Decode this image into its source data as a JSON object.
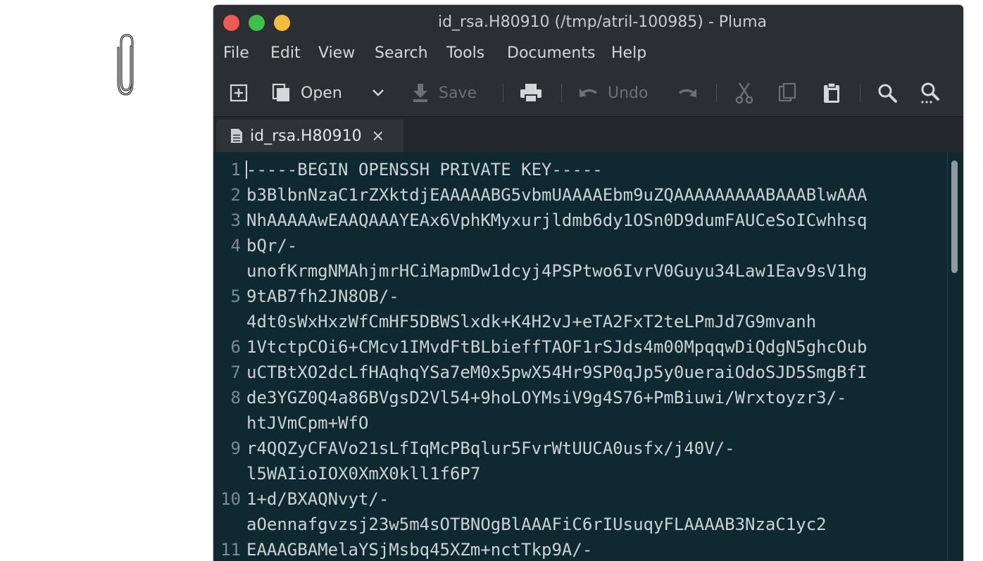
{
  "window": {
    "title": "id_rsa.H80910 (/tmp/atril-100985) - Pluma"
  },
  "menubar": [
    "File",
    "Edit",
    "View",
    "Search",
    "Tools",
    "Documents",
    "Help"
  ],
  "toolbar": {
    "new_icon": "new-document-icon",
    "open_label": "Open",
    "save_label": "Save",
    "undo_label": "Undo"
  },
  "tab": {
    "label": "id_rsa.H80910",
    "close": "×"
  },
  "editor": {
    "lines": [
      {
        "num": "1",
        "text": "-----BEGIN OPENSSH PRIVATE KEY-----"
      },
      {
        "num": "2",
        "text": "b3BlbnNzaC1rZXktdjEAAAAABG5vbmUAAAAEbm9uZQAAAAAAAAABAAABlwAAA"
      },
      {
        "num": "3",
        "text": "NhAAAAAwEAAQAAAYEAx6VphKMyxurjldmb6dy1OSn0D9dumFAUCeSoICwhhsq"
      },
      {
        "num": "4",
        "text": "bQr/-"
      },
      {
        "num": "",
        "text": "unofKrmgNMAhjmrHCiMapmDw1dcyj4PSPtwo6IvrV0Guyu34Law1Eav9sV1hg"
      },
      {
        "num": "5",
        "text": "9tAB7fh2JN8OB/-"
      },
      {
        "num": "",
        "text": "4dt0sWxHxzWfCmHF5DBWSlxdk+K4H2vJ+eTA2FxT2teLPmJd7G9mvanh"
      },
      {
        "num": "6",
        "text": "1VtctpCOi6+CMcv1IMvdFtBLbieffTAOF1rSJds4m00MpqqwDiQdgN5ghcOub"
      },
      {
        "num": "7",
        "text": "uCTBtXO2dcLfHAqhqYSa7eM0x5pwX54Hr9SP0qJp5y0ueraiOdoSJD5SmgBfI"
      },
      {
        "num": "8",
        "text": "de3YGZ0Q4a86BVgsD2Vl54+9hoLOYMsiV9g4S76+PmBiuwi/Wrxtoyzr3/-"
      },
      {
        "num": "",
        "text": "htJVmCpm+WfO"
      },
      {
        "num": "9",
        "text": "r4QQZyCFAVo21sLfIqMcPBqlur5FvrWtUUCA0usfx/j40V/-"
      },
      {
        "num": "",
        "text": "l5WAIioIOX0XmX0kll1f6P7"
      },
      {
        "num": "10",
        "text": "1+d/BXAQNvyt/-"
      },
      {
        "num": "",
        "text": "aOennafgvzsj23w5m4sOTBNOgBlAAAFiC6rIUsuqyFLAAAAB3NzaC1yc2"
      },
      {
        "num": "11",
        "text": "EAAAGBAMelaYSjMsbq45XZm+nctTkp9A/-"
      }
    ]
  },
  "colors": {
    "window_bg": "#2b2e33",
    "editor_bg": "#0f2930",
    "close": "#ef5a52",
    "minimize": "#3cc048",
    "maximize": "#f4bd3a"
  }
}
